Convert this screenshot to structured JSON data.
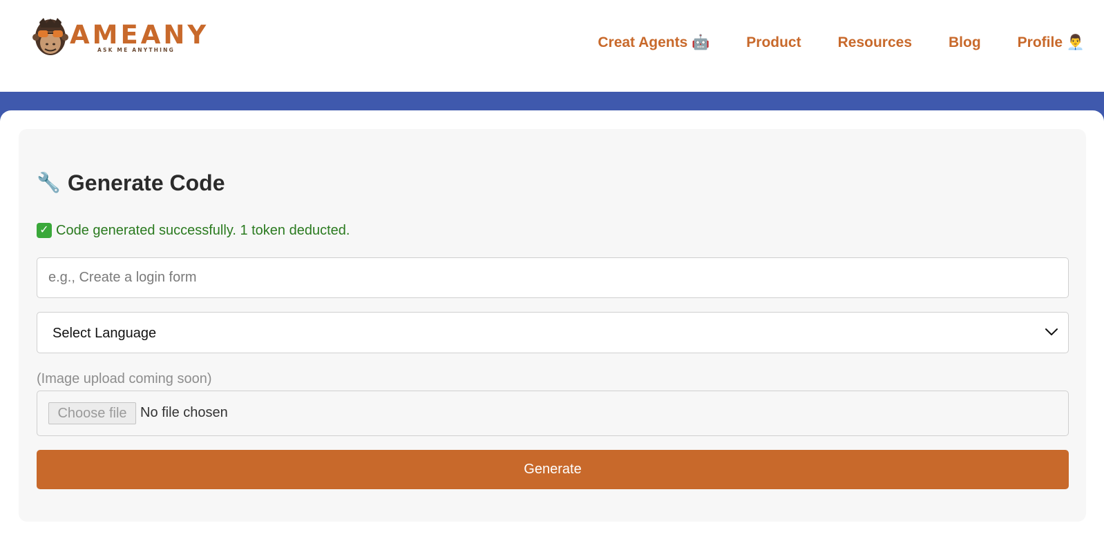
{
  "brand": {
    "name": "AMEANY",
    "tagline": "ASK ME ANYTHING",
    "accent_color": "#c8692b",
    "band_color": "#3f59ad"
  },
  "nav": {
    "items": [
      {
        "label": "Creat Agents 🤖"
      },
      {
        "label": "Product"
      },
      {
        "label": "Resources"
      },
      {
        "label": "Blog"
      },
      {
        "label": "Profile 👨‍💼"
      }
    ]
  },
  "main": {
    "title_icon": "🔧",
    "title": "Generate Code",
    "status_icon": "check-mark-icon",
    "status_message": "Code generated successfully. 1 token deducted.",
    "status_color": "#2a7a1f",
    "prompt_input": {
      "value": "",
      "placeholder": "e.g., Create a login form"
    },
    "language_select": {
      "selected": "Select Language"
    },
    "upload": {
      "label": "(Image upload coming soon)",
      "button_label": "Choose file",
      "status": "No file chosen"
    },
    "generate_label": "Generate"
  }
}
